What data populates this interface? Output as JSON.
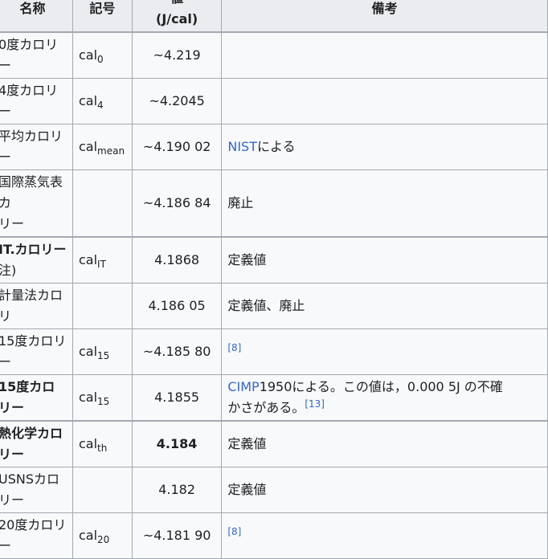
{
  "header": {
    "col1": "名称",
    "col2": "記号",
    "col3_top": "値",
    "col3_unit": "(J/cal)",
    "col4": "備考"
  },
  "rows": [
    {
      "name": "0度カロリー",
      "sym": "cal",
      "sub": "0",
      "value": "~4.219",
      "note": "",
      "ref": ""
    },
    {
      "name": "4度カロリー",
      "sym": "cal",
      "sub": "4",
      "value": "~4.2045",
      "note": "",
      "ref": ""
    },
    {
      "name": "平均カロリー",
      "sym": "cal",
      "sub": "mean",
      "value": "~4.190 02",
      "note_link": "NIST",
      "note": "による",
      "ref": ""
    },
    {
      "name_l1": "国際蒸気表カ",
      "name_l2": "リー",
      "sym": "",
      "sub": "",
      "value": "~4.186 84",
      "note": "廃止",
      "ref": ""
    },
    {
      "name_l1": "IT.カロリー",
      "name_l2": "注)",
      "sym": "cal",
      "sub": "IT",
      "value": "4.1868",
      "note": "定義値",
      "ref": ""
    },
    {
      "name_l1": "計量法カロリ",
      "name_l2": "",
      "sym": "",
      "sub": "",
      "value": "4.186 05",
      "note": "定義値、廃止",
      "ref": ""
    },
    {
      "name": "15度カロリー",
      "sym": "cal",
      "sub": "15",
      "value": "~4.185 80",
      "note": "",
      "ref": "[8]"
    },
    {
      "name": "15度カロリー",
      "sym": "cal",
      "sub": "15",
      "value": "4.1855",
      "note_link": "CIMP",
      "note_l1": "1950による。この値は，0.000 5J の不確",
      "note_l2": "かさがある。",
      "ref": "[13]"
    },
    {
      "name": "熱化学カロリー",
      "sym": "cal",
      "sub": "th",
      "value": "4.184",
      "note": "定義値",
      "ref": ""
    },
    {
      "name": "USNSカロリー",
      "sym": "",
      "sub": "",
      "value": "4.182",
      "note": "定義値",
      "ref": ""
    },
    {
      "name": "20度カロリー",
      "sym": "cal",
      "sub": "20",
      "value": "~4.181 90",
      "note": "",
      "ref": "[8]"
    }
  ]
}
